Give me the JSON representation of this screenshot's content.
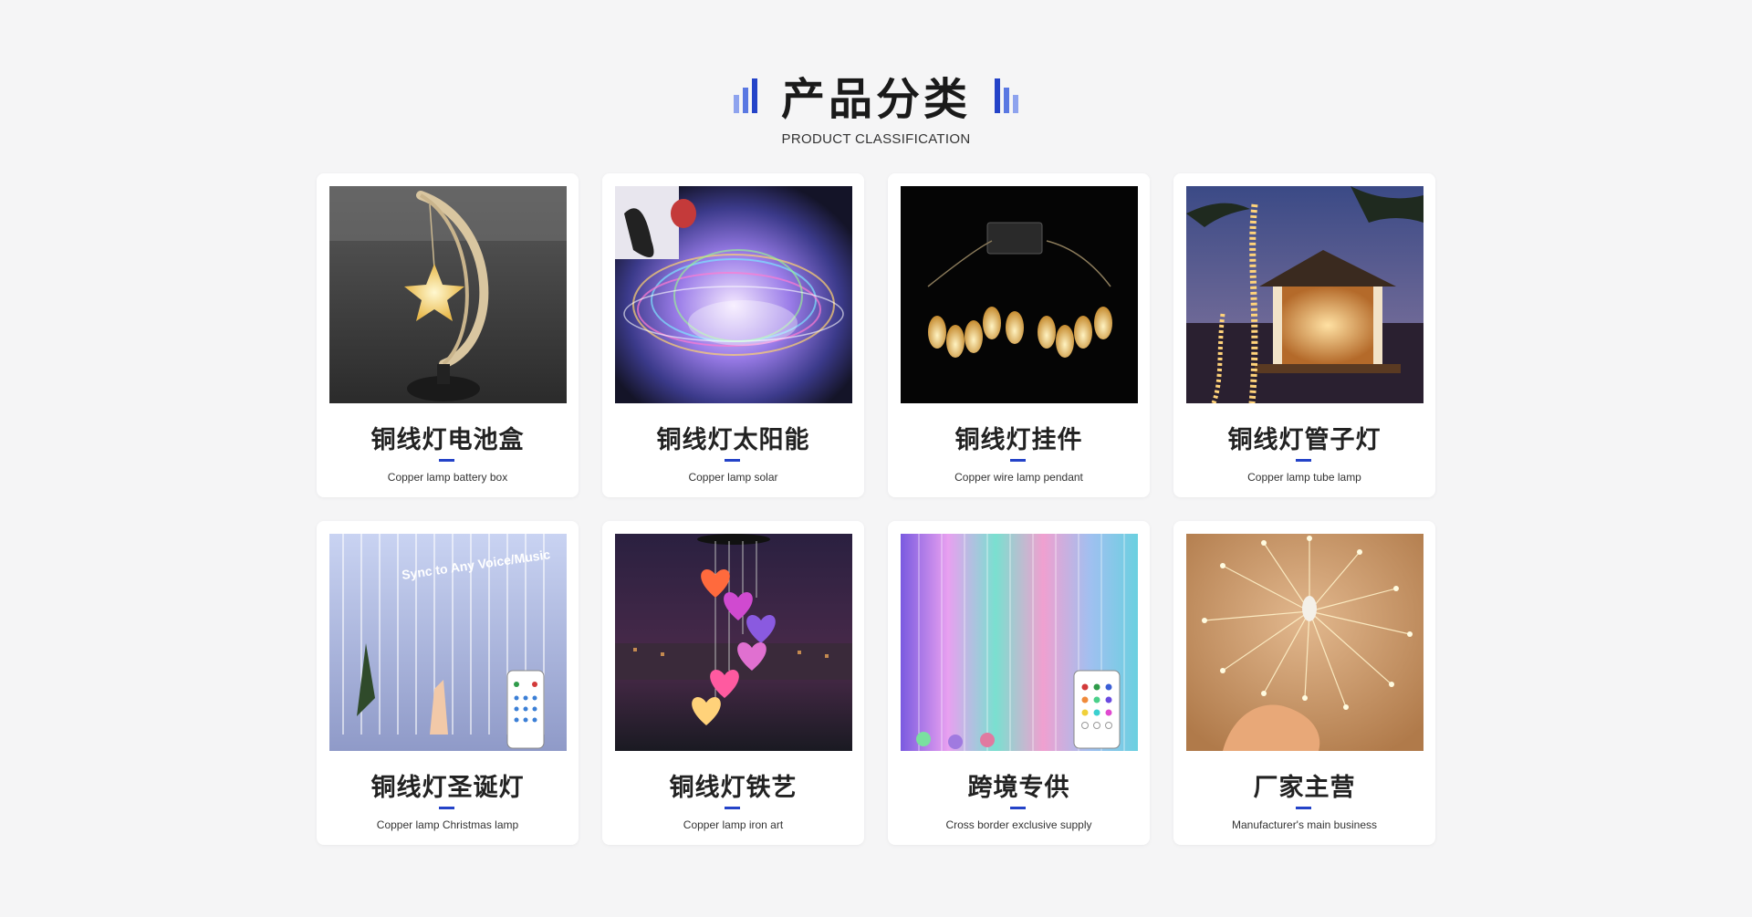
{
  "header": {
    "title": "产品分类",
    "subtitle": "PRODUCT CLASSIFICATION"
  },
  "colors": {
    "accent": "#2443c8",
    "background": "#f5f5f6"
  },
  "products": [
    {
      "title": "铜线灯电池盒",
      "subtitle": "Copper lamp battery box",
      "image": "moon-star-lamp-photo"
    },
    {
      "title": "铜线灯太阳能",
      "subtitle": "Copper lamp solar",
      "image": "colorful-wire-lights-photo"
    },
    {
      "title": "铜线灯挂件",
      "subtitle": "Copper wire lamp pendant",
      "image": "teardrop-pendant-lights-photo"
    },
    {
      "title": "铜线灯管子灯",
      "subtitle": "Copper lamp tube lamp",
      "image": "gazebo-tube-lights-photo"
    },
    {
      "title": "铜线灯圣诞灯",
      "subtitle": "Copper lamp Christmas lamp",
      "image": "curtain-lights-remote-photo",
      "image_text": "Sync to Any Voice/Music"
    },
    {
      "title": "铜线灯铁艺",
      "subtitle": "Copper lamp iron art",
      "image": "heart-wind-chime-photo"
    },
    {
      "title": "跨境专供",
      "subtitle": "Cross border exclusive supply",
      "image": "rgb-curtain-lights-photo"
    },
    {
      "title": "厂家主营",
      "subtitle": "Manufacturer's main business",
      "image": "firework-starburst-lights-photo"
    }
  ]
}
